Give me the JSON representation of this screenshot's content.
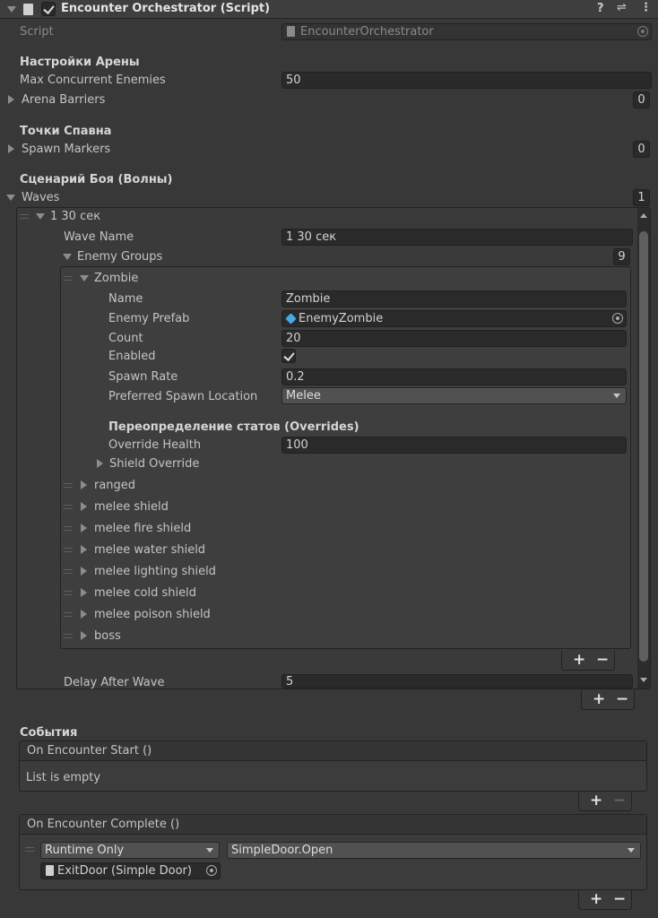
{
  "header": {
    "title": "Encounter Orchestrator (Script)",
    "script_label": "Script",
    "script_value": "EncounterOrchestrator"
  },
  "arena": {
    "section_title": "Настройки Арены",
    "max_enemies_label": "Max Concurrent Enemies",
    "max_enemies_value": "50",
    "barriers_label": "Arena Barriers",
    "barriers_count": "0"
  },
  "spawn": {
    "section_title": "Точки Спавна",
    "markers_label": "Spawn Markers",
    "markers_count": "0"
  },
  "scenario": {
    "section_title": "Сценарий Боя (Волны)",
    "waves_label": "Waves",
    "waves_count": "1"
  },
  "wave": {
    "element_title": "1 30 сек",
    "name_label": "Wave Name",
    "name_value": "1 30 сек",
    "groups_label": "Enemy Groups",
    "groups_count": "9",
    "delay_label": "Delay After Wave",
    "delay_value": "5"
  },
  "zombie": {
    "title": "Zombie",
    "name_label": "Name",
    "name_value": "Zombie",
    "prefab_label": "Enemy Prefab",
    "prefab_value": "EnemyZombie",
    "count_label": "Count",
    "count_value": "20",
    "enabled_label": "Enabled",
    "rate_label": "Spawn Rate",
    "rate_value": "0.2",
    "location_label": "Preferred Spawn Location",
    "location_value": "Melee",
    "overrides_title": "Переопределение статов (Overrides)",
    "health_label": "Override Health",
    "health_value": "100",
    "shield_label": "Shield Override"
  },
  "groups": [
    "ranged",
    "melee shield",
    "melee fire shield",
    "melee water shield",
    "melee lighting shield",
    "melee cold shield",
    "melee poison shield",
    "boss"
  ],
  "events": {
    "section_title": "События",
    "start_title": "On Encounter Start ()",
    "start_empty": "List is empty",
    "complete_title": "On Encounter Complete ()",
    "runtime_value": "Runtime Only",
    "method_value": "SimpleDoor.Open",
    "target_value": "ExitDoor (Simple Door)"
  },
  "buttons": {
    "plus": "+",
    "minus": "−"
  },
  "colors": {
    "background": "#383838",
    "field": "#2a2a2a",
    "text": "#c4c4c4",
    "prefab_icon": "#4aa8e8"
  }
}
